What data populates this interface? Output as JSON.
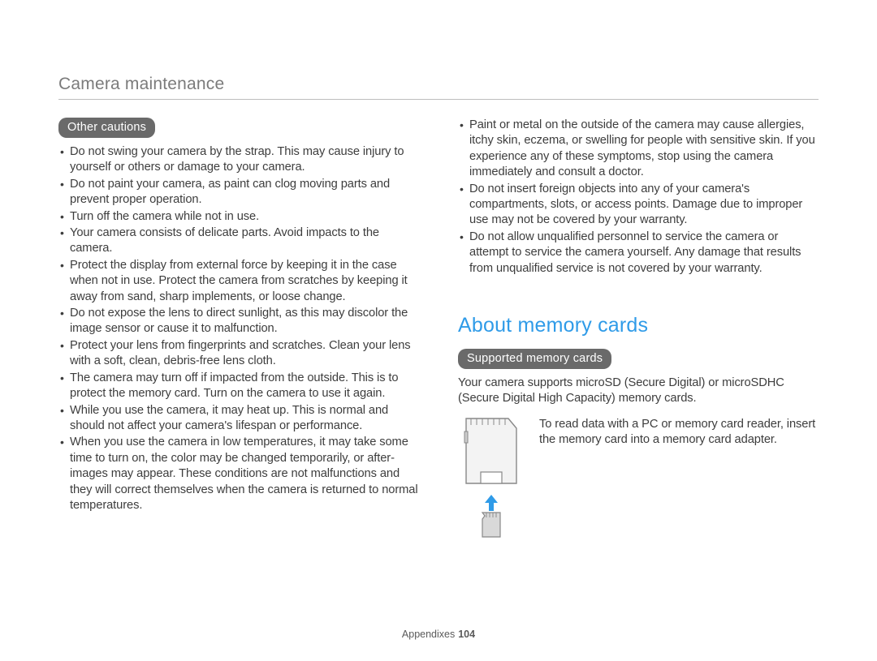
{
  "header": {
    "title": "Camera maintenance"
  },
  "left": {
    "badge": "Other cautions",
    "items": [
      "Do not swing your camera by the strap. This may cause injury to yourself or others or damage to your camera.",
      "Do not paint your camera, as paint can clog moving parts and prevent proper operation.",
      "Turn off the camera while not in use.",
      "Your camera consists of delicate parts. Avoid impacts to the camera.",
      "Protect the display from external force by keeping it in the case when not in use. Protect the camera from scratches by keeping it away from sand, sharp implements, or loose change.",
      "Do not expose the lens to direct sunlight, as this may discolor the image sensor or cause it to malfunction.",
      "Protect your lens from fingerprints and scratches. Clean your lens with a soft, clean, debris-free lens cloth.",
      "The camera may turn off if impacted from the outside. This is to protect the memory card. Turn on the camera to use it again.",
      "While you use the camera, it may heat up. This is normal and should not affect your camera's lifespan or performance.",
      "When you use the camera in low temperatures, it may take some time to turn on, the color may be changed temporarily, or after-images may appear. These conditions are not malfunctions and they will correct themselves when the camera is returned to normal temperatures."
    ]
  },
  "right": {
    "top_items": [
      "Paint or metal on the outside of the camera may cause allergies, itchy skin, eczema, or swelling for people with sensitive skin. If you experience any of these symptoms, stop using the camera immediately and consult a doctor.",
      "Do not insert foreign objects into any of your camera's compartments, slots, or access points. Damage due to improper use may not be covered by your warranty.",
      "Do not allow unqualified personnel to service the camera or attempt to service the camera yourself. Any damage that results from unqualified service is not covered by your warranty."
    ],
    "section_heading": "About memory cards",
    "supported_badge": "Supported memory cards",
    "supported_text": "Your camera supports microSD (Secure Digital) or microSDHC (Secure Digital High Capacity) memory cards.",
    "adapter_text": "To read data with a PC or memory card reader, insert the memory card into a memory card adapter."
  },
  "footer": {
    "section": "Appendixes",
    "page": "104"
  },
  "icons": {
    "sd_adapter": "sd-adapter-icon",
    "micro_sd": "micro-sd-icon",
    "arrow_up": "arrow-up-icon"
  }
}
